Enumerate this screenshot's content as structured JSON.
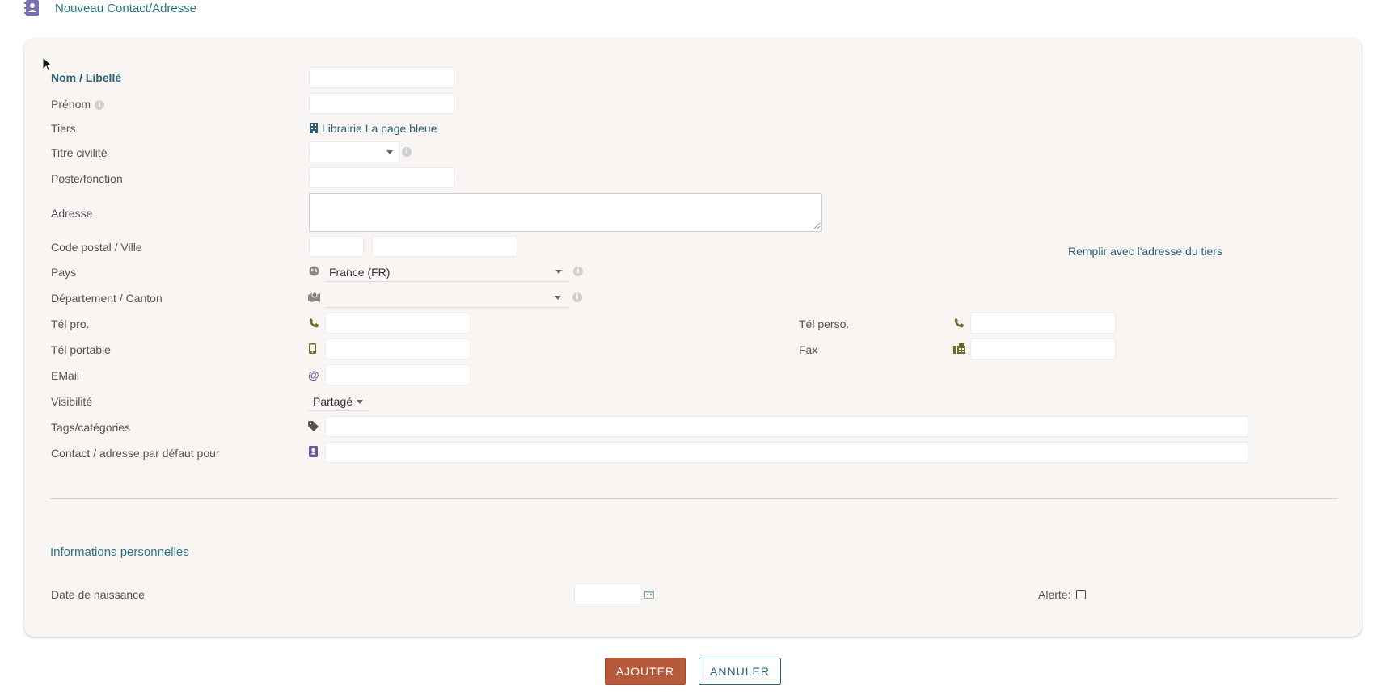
{
  "page": {
    "title": "Nouveau Contact/Adresse"
  },
  "form": {
    "labels": {
      "name": "Nom / Libellé",
      "firstname": "Prénom",
      "thirdparty": "Tiers",
      "civility": "Titre civilité",
      "job": "Poste/fonction",
      "address": "Adresse",
      "zip_town": "Code postal / Ville",
      "country": "Pays",
      "state": "Département / Canton",
      "phone_pro": "Tél pro.",
      "phone_perso": "Tél perso.",
      "phone_mobile": "Tél portable",
      "fax": "Fax",
      "email": "EMail",
      "visibility": "Visibilité",
      "tags": "Tags/catégories",
      "default_contact": "Contact / adresse par défaut pour"
    },
    "thirdparty_link": "Librairie La page bleue",
    "fill_address_link": "Remplir avec l'adresse du tiers",
    "country_value": "France (FR)",
    "visibility_value": "Partagé",
    "icons": {
      "thirdparty": "building-icon",
      "country": "globe-icon",
      "state": "map-icon",
      "phone": "phone-icon",
      "mobile": "mobile-phone-icon",
      "fax": "fax-icon",
      "email": "at-icon",
      "tags": "tag-icon",
      "contact": "address-book-icon"
    }
  },
  "personal": {
    "section_title": "Informations personnelles",
    "birthday_label": "Date de naissance",
    "alert_label": "Alerte:"
  },
  "buttons": {
    "add": "AJOUTER",
    "cancel": "ANNULER"
  },
  "colors": {
    "accent": "#2a7686",
    "primary_button": "#b75a3c",
    "icon_olive": "#6b6b2b",
    "icon_purple": "#6c5b9b"
  }
}
